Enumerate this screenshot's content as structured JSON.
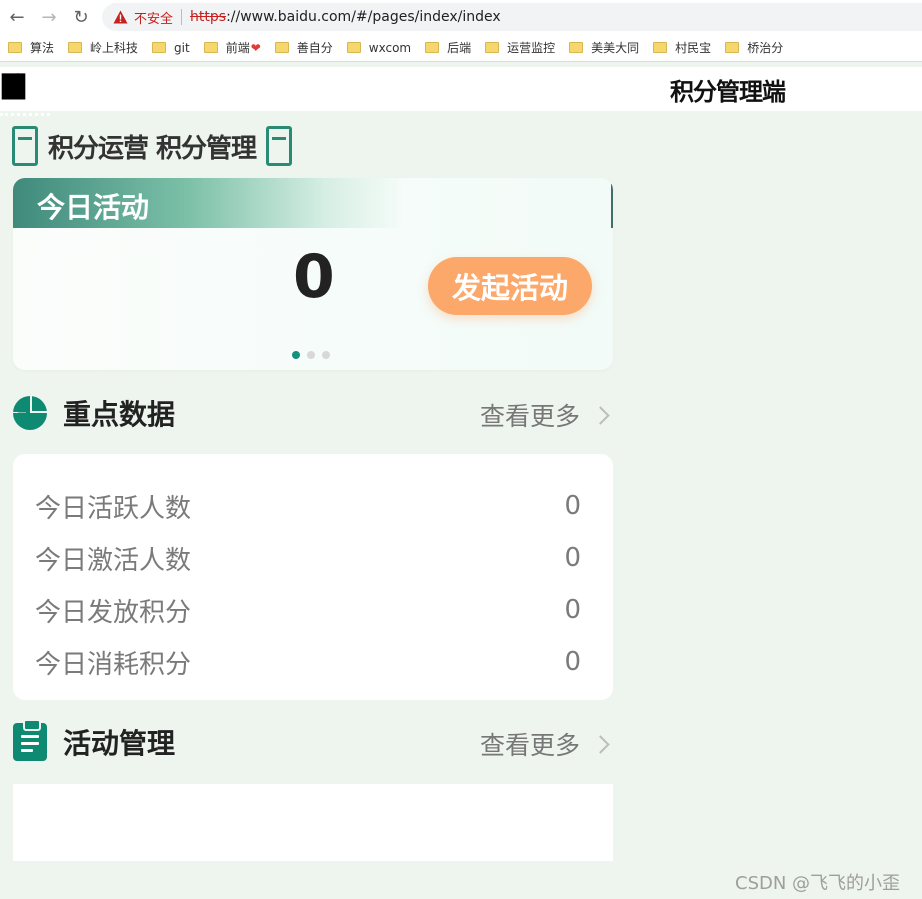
{
  "browser": {
    "security_label": "不安全",
    "url_scheme": "https",
    "url_rest": "://www.baidu.com/#/pages/index/index",
    "bookmarks": [
      "算法",
      "岭上科技",
      "git",
      "前端",
      "善自分",
      "wxcom",
      "后端",
      "运营监控",
      "美美大同",
      "村民宝",
      "桥治分"
    ]
  },
  "header": {
    "left_glyph": "█▌",
    "title": "积分管理端"
  },
  "mini_program": {
    "name": "积分运营 积分管理"
  },
  "activity_card": {
    "title": "今日活动",
    "count": "0",
    "start_button": "发起活动",
    "carousel_active_index": 0,
    "carousel_total": 3
  },
  "key_data": {
    "title": "重点数据",
    "more": "查看更多",
    "rows": [
      {
        "label": "今日活跃人数",
        "value": "0"
      },
      {
        "label": "今日激活人数",
        "value": "0"
      },
      {
        "label": "今日发放积分",
        "value": "0"
      },
      {
        "label": "今日消耗积分",
        "value": "0"
      }
    ]
  },
  "activity_mgmt": {
    "title": "活动管理",
    "more": "查看更多"
  },
  "watermark": "CSDN @飞飞的小歪",
  "colors": {
    "accent": "#0f8a72",
    "button": "#fca86a",
    "page_bg": "#eef5ee"
  }
}
